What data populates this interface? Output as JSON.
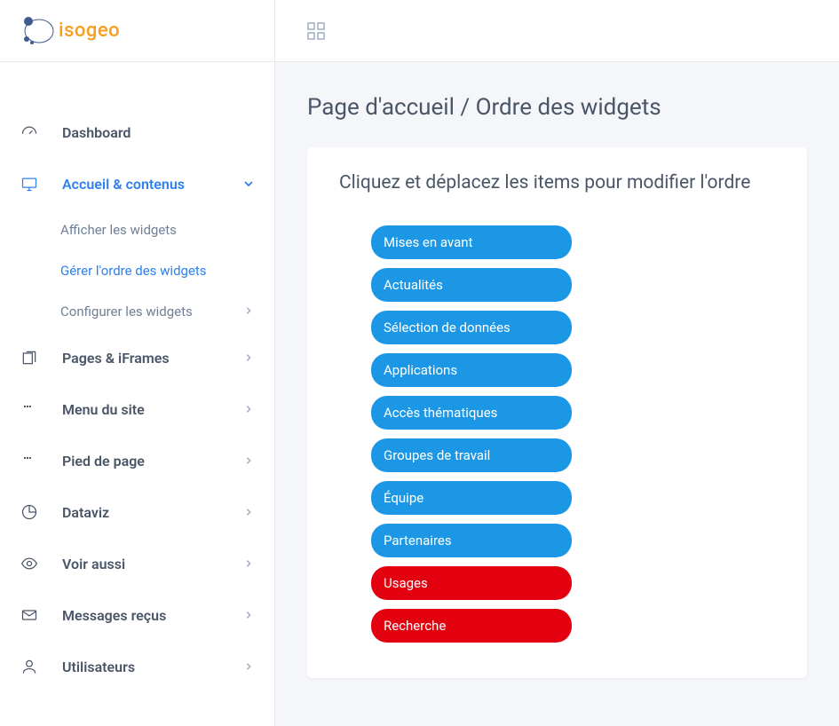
{
  "brand": {
    "name": "isogeo"
  },
  "sidebar": {
    "items": [
      {
        "label": "Dashboard",
        "icon": "gauge-icon",
        "expandable": false,
        "active": false
      },
      {
        "label": "Accueil & contenus",
        "icon": "display-icon",
        "expandable": true,
        "active": true,
        "children": [
          {
            "label": "Afficher les widgets",
            "active": false,
            "expandable": false
          },
          {
            "label": "Gérer l'ordre des widgets",
            "active": true,
            "expandable": false
          },
          {
            "label": "Configurer les widgets",
            "active": false,
            "expandable": true
          }
        ]
      },
      {
        "label": "Pages & iFrames",
        "icon": "pages-icon",
        "expandable": true,
        "active": false
      },
      {
        "label": "Menu du site",
        "icon": "menu-icon",
        "expandable": true,
        "active": false
      },
      {
        "label": "Pied de page",
        "icon": "footer-icon",
        "expandable": true,
        "active": false
      },
      {
        "label": "Dataviz",
        "icon": "chart-icon",
        "expandable": true,
        "active": false
      },
      {
        "label": "Voir aussi",
        "icon": "eye-icon",
        "expandable": true,
        "active": false
      },
      {
        "label": "Messages reçus",
        "icon": "mail-icon",
        "expandable": true,
        "active": false
      },
      {
        "label": "Utilisateurs",
        "icon": "user-icon",
        "expandable": true,
        "active": false
      }
    ]
  },
  "page": {
    "title": "Page d'accueil / Ordre des widgets",
    "card_heading": "Cliquez et déplacez les items pour modifier l'ordre",
    "widgets": [
      {
        "label": "Mises en avant",
        "color": "blue"
      },
      {
        "label": "Actualités",
        "color": "blue"
      },
      {
        "label": "Sélection de données",
        "color": "blue"
      },
      {
        "label": "Applications",
        "color": "blue"
      },
      {
        "label": "Accès thématiques",
        "color": "blue"
      },
      {
        "label": "Groupes de travail",
        "color": "blue"
      },
      {
        "label": "Équipe",
        "color": "blue"
      },
      {
        "label": "Partenaires",
        "color": "blue"
      },
      {
        "label": "Usages",
        "color": "red"
      },
      {
        "label": "Recherche",
        "color": "red"
      }
    ]
  }
}
